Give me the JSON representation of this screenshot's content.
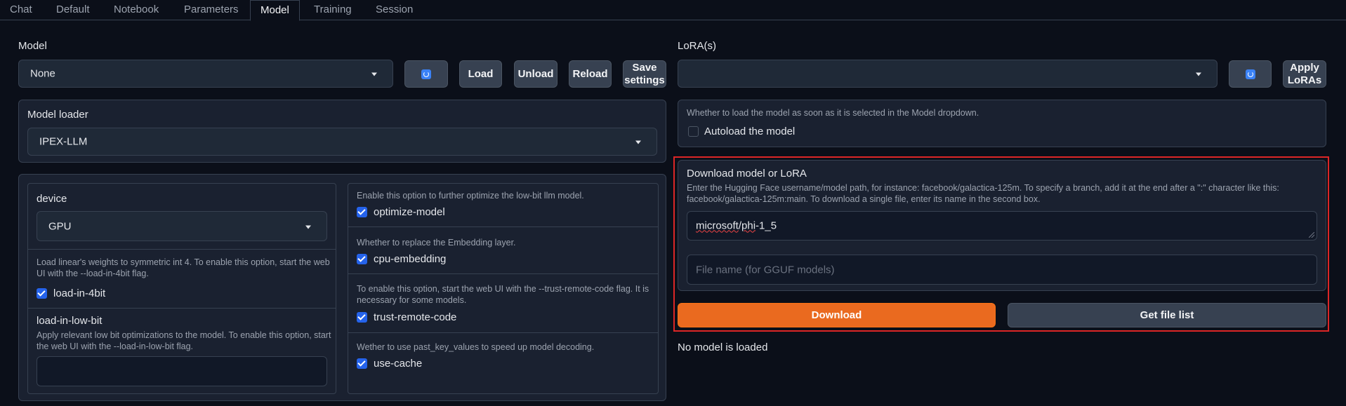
{
  "tabs": [
    "Chat",
    "Default",
    "Notebook",
    "Parameters",
    "Model",
    "Training",
    "Session"
  ],
  "model_section": {
    "label": "Model",
    "dropdown_value": "None",
    "load_label": "Load",
    "unload_label": "Unload",
    "reload_label": "Reload",
    "save_settings_line1": "Save",
    "save_settings_line2": "settings"
  },
  "loader": {
    "label": "Model loader",
    "value": "IPEX-LLM"
  },
  "options": {
    "device_label": "device",
    "device_value": "GPU",
    "load_in_4bit_info": "Load linear's weights to symmetric int 4. To enable this option, start the web UI with the --load-in-4bit flag.",
    "load_in_4bit_label": "load-in-4bit",
    "low_bit_label": "load-in-low-bit",
    "low_bit_info": "Apply relevant low bit optimizations to the model. To enable this option, start the web UI with the --load-in-low-bit flag.",
    "low_bit_value": "",
    "optimize_info": "Enable this option to further optimize the low-bit llm model.",
    "optimize_label": "optimize-model",
    "cpu_emb_info": "Whether to replace the Embedding layer.",
    "cpu_emb_label": "cpu-embedding",
    "trust_info": "To enable this option, start the web UI with the --trust-remote-code flag. It is necessary for some models.",
    "trust_label": "trust-remote-code",
    "cache_info": "Wether to use past_key_values to speed up model decoding.",
    "cache_label": "use-cache"
  },
  "lora": {
    "label": "LoRA(s)",
    "dropdown_value": "",
    "apply_line1": "Apply",
    "apply_line2": "LoRAs"
  },
  "autoload": {
    "info": "Whether to load the model as soon as it is selected in the Model dropdown.",
    "label": "Autoload the model"
  },
  "download": {
    "title": "Download model or LoRA",
    "info": "Enter the Hugging Face username/model path, for instance: facebook/galactica-125m. To specify a branch, add it at the end after a \":\" character like this: facebook/galactica-125m:main. To download a single file, enter its name in the second box.",
    "path_value_a": "microsoft",
    "path_value_b": "/",
    "path_value_c": "phi",
    "path_value_d": "-1_5",
    "file_placeholder": "File name (for GGUF models)",
    "download_label": "Download",
    "get_list_label": "Get file list"
  },
  "status": "No model is loaded",
  "colors": {
    "background": "#0b0f19",
    "accent_orange": "#ea6a1f",
    "highlight_red": "#dc2626",
    "checkbox_blue": "#2563eb"
  }
}
